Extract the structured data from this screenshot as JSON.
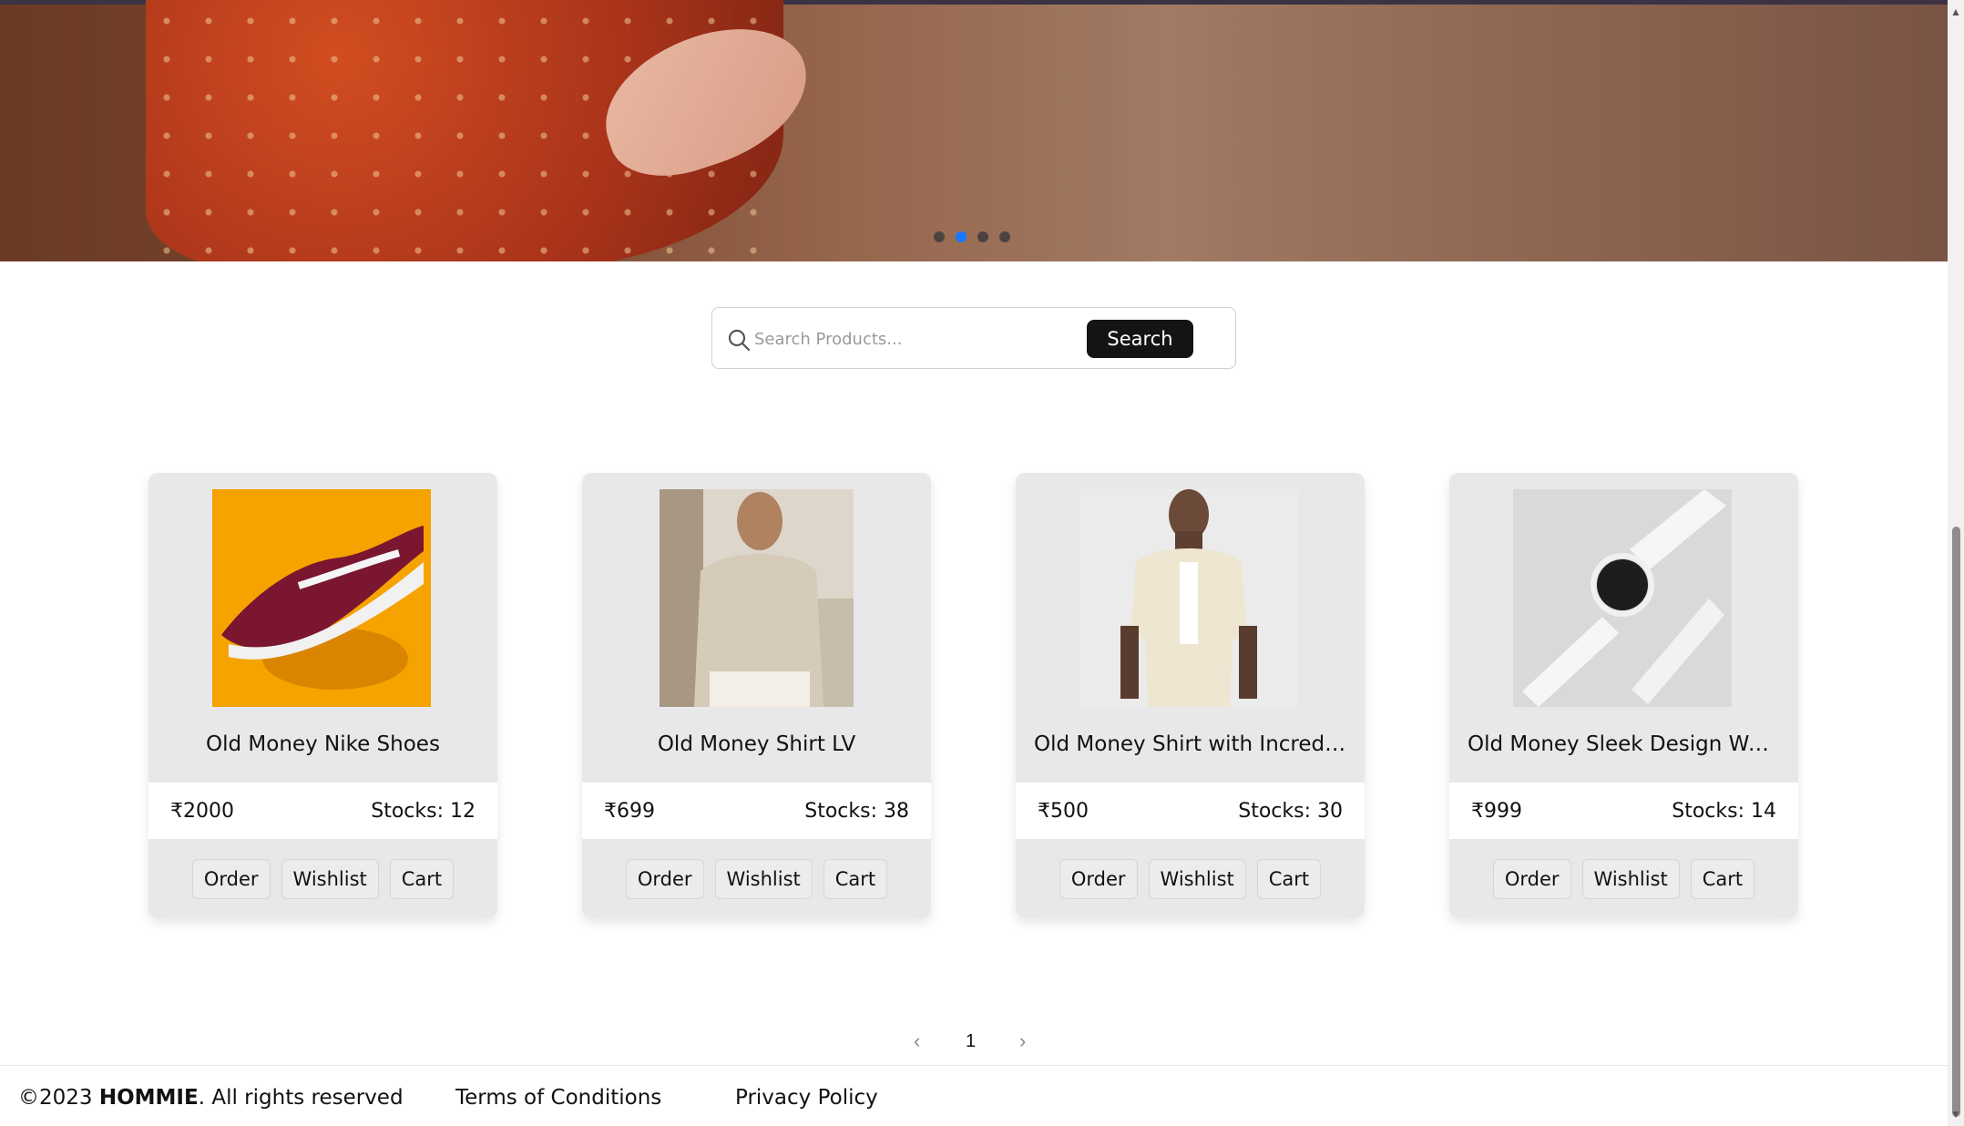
{
  "carousel": {
    "slides": 4,
    "active_index": 1
  },
  "search": {
    "placeholder": "Search Products...",
    "button_label": "Search"
  },
  "products": [
    {
      "name": "Old Money Nike Shoes",
      "price": "₹2000",
      "stocks": "Stocks: 12",
      "buttons": [
        "Order",
        "Wishlist",
        "Cart"
      ]
    },
    {
      "name": "Old Money Shirt LV",
      "price": "₹699",
      "stocks": "Stocks: 38",
      "buttons": [
        "Order",
        "Wishlist",
        "Cart"
      ]
    },
    {
      "name": "Old Money Shirt with Incredi...",
      "price": "₹500",
      "stocks": "Stocks: 30",
      "buttons": [
        "Order",
        "Wishlist",
        "Cart"
      ]
    },
    {
      "name": "Old Money Sleek Design Wa...",
      "price": "₹999",
      "stocks": "Stocks: 14",
      "buttons": [
        "Order",
        "Wishlist",
        "Cart"
      ]
    }
  ],
  "pagination": {
    "current_page": "1",
    "prev_icon": "chevron-left-icon",
    "next_icon": "chevron-right-icon"
  },
  "footer": {
    "copyright_prefix": "©2023 ",
    "brand": "HOMMIE",
    "copyright_suffix": ". All rights reserved",
    "terms": "Terms of Conditions",
    "privacy": "Privacy Policy"
  },
  "colors": {
    "accent": "#1677ff",
    "search_button": "#141414",
    "card_bg": "#e8e8ea"
  }
}
